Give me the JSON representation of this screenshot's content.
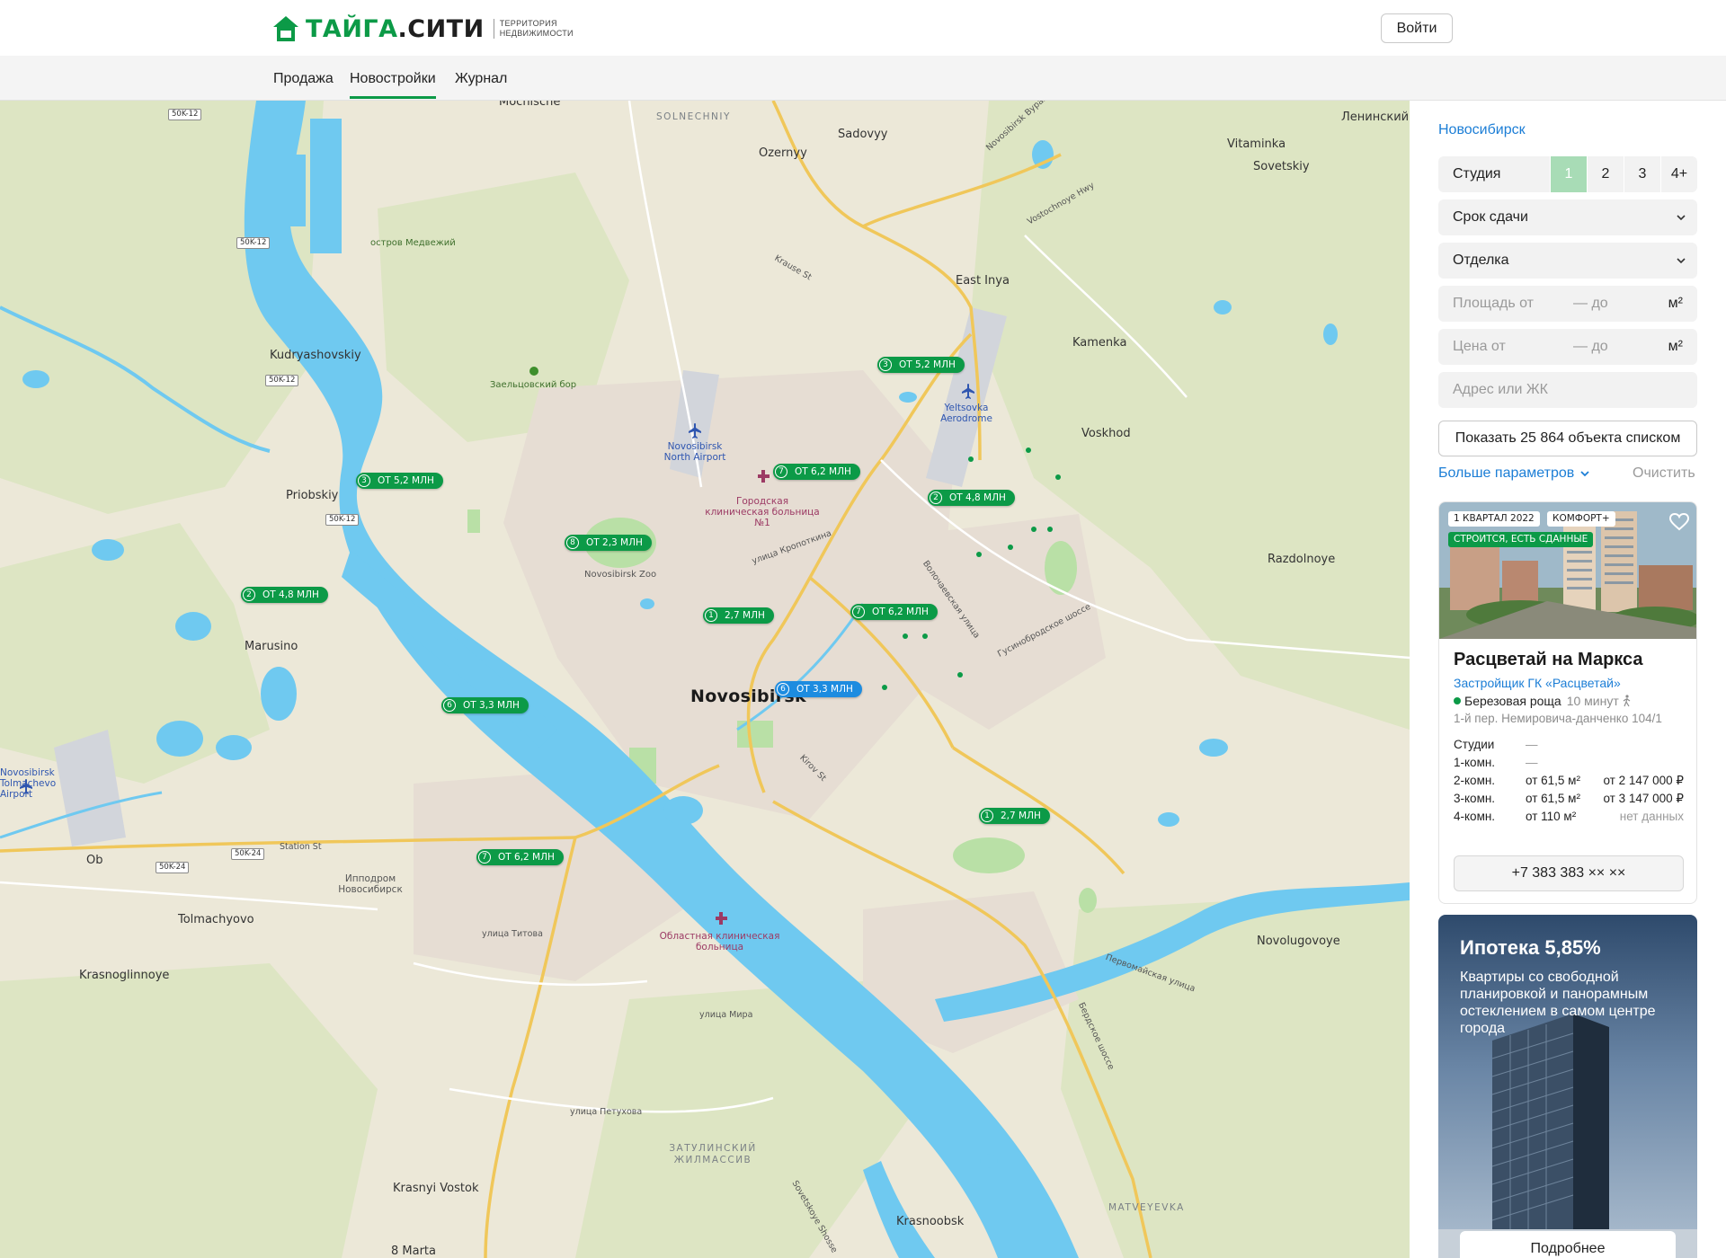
{
  "header": {
    "logo_green": "ТАЙГА",
    "logo_dark": ".СИТИ",
    "logo_tagline": "ТЕРРИТОРИЯ НЕДВИЖИМОСТИ",
    "login_label": "Войти"
  },
  "nav": [
    {
      "label": "Продажа"
    },
    {
      "label": "Новостройки",
      "active": true
    },
    {
      "label": "Журнал"
    }
  ],
  "map": {
    "places": [
      "Mochische",
      "SOLNECHNIY",
      "Sadovyy",
      "Ozernyy",
      "Ленинский",
      "Vitaminka",
      "Sovetskiy",
      "остров Медвежий",
      "East Inya",
      "Kudryashovskiy",
      "Заельцовский бор",
      "Kamenka",
      "Yeltsovka Aerodrome",
      "Novosibirsk North Airport",
      "Voskhod",
      "Priobskiy",
      "Городская клиническая больница №1",
      "Novosibirsk Zoo",
      "Razdolnoye",
      "Marusino",
      "Novosibirsk",
      "Novosibirsk Tolmachevo Airport",
      "Ob",
      "Ипподром Новосибирск",
      "Tolmachyovo",
      "Krasnoglinnoye",
      "Областная клиническая больница",
      "Novolugovoye",
      "ЗАТУЛИНСКИЙ ЖИЛМАССИВ",
      "Krasnyi Vostok",
      "Krasnoobsk",
      "MATVEYEVKA",
      "8 Marta"
    ],
    "streets": [
      "Novosibirsk Bypass N",
      "Vostochnoye Hwy",
      "Krause St",
      "улица Кропоткина",
      "Волочаевская улица",
      "Гусинобродское шоссе",
      "Kirov St",
      "Station St",
      "улица Титова",
      "улица Мира",
      "улица Петухова",
      "Sovetskoye Shosse",
      "Бердское шоссе",
      "Первомайская улица"
    ],
    "shields": [
      "50K-12",
      "50K-12",
      "50K-12",
      "50K-12",
      "50K-24",
      "50K-24"
    ],
    "pins": [
      {
        "num": "3",
        "price": "ОТ 5,2 МЛН",
        "color": "green"
      },
      {
        "num": "3",
        "price": "ОТ 5,2 МЛН",
        "color": "green"
      },
      {
        "num": "7",
        "price": "ОТ 6,2 МЛН",
        "color": "green"
      },
      {
        "num": "2",
        "price": "ОТ 4,8 МЛН",
        "color": "green"
      },
      {
        "num": "8",
        "price": "ОТ 2,3 МЛН",
        "color": "green"
      },
      {
        "num": "2",
        "price": "ОТ 4,8 МЛН",
        "color": "green"
      },
      {
        "num": "1",
        "price": "2,7 МЛН",
        "color": "green"
      },
      {
        "num": "7",
        "price": "ОТ 6,2 МЛН",
        "color": "green"
      },
      {
        "num": "6",
        "price": "ОТ 3,3 МЛН",
        "color": "blue"
      },
      {
        "num": "6",
        "price": "ОТ 3,3 МЛН",
        "color": "green"
      },
      {
        "num": "1",
        "price": "2,7 МЛН",
        "color": "green"
      },
      {
        "num": "7",
        "price": "ОТ 6,2 МЛН",
        "color": "green"
      }
    ]
  },
  "filters": {
    "city": "Новосибирск",
    "rooms": {
      "studio": "Студия",
      "options": [
        "1",
        "2",
        "3",
        "4+"
      ],
      "selected": "1"
    },
    "deadline": "Срок сдачи",
    "finish": "Отделка",
    "area_from": "Площадь от",
    "area_to": "— до",
    "area_unit": "м²",
    "price_from": "Цена от",
    "price_to": "— до",
    "price_unit": "м²",
    "address_placeholder": "Адрес или ЖК",
    "show_list": "Показать 25 864 объекта списком",
    "more_params": "Больше параметров",
    "clear": "Очистить"
  },
  "card": {
    "badge_quarter": "1 КВАРТАЛ 2022",
    "badge_class": "КОМФОРТ+",
    "badge_status": "СТРОИТСЯ, ЕСТЬ СДАННЫЕ",
    "title": "Расцветай на Маркса",
    "developer": "Застройщик ГК «Расцветай»",
    "metro": "Березовая роща",
    "metro_time": "10 минут",
    "address": "1-й пер. Немировича-данченко 104/1",
    "rows": [
      {
        "type": "Студии",
        "area": "—",
        "price": ""
      },
      {
        "type": "1-комн.",
        "area": "—",
        "price": ""
      },
      {
        "type": "2-комн.",
        "area": "от 61,5 м²",
        "price": "от 2 147 000 ₽"
      },
      {
        "type": "3-комн.",
        "area": "от 61,5 м²",
        "price": "от 3 147 000 ₽"
      },
      {
        "type": "4-комн.",
        "area": "от 110 м²",
        "price": "нет данных"
      }
    ],
    "phone": "+7 383 383 ×× ××"
  },
  "promo": {
    "title": "Ипотека 5,85%",
    "text": "Квартиры со свободной планировкой и панорамным остеклением в самом центре города",
    "button": "Подробнее"
  },
  "colors": {
    "brand_green": "#0c9a47",
    "link_blue": "#1c7ed6",
    "water": "#6fc9f0",
    "selected_room": "#a8dcb6"
  }
}
